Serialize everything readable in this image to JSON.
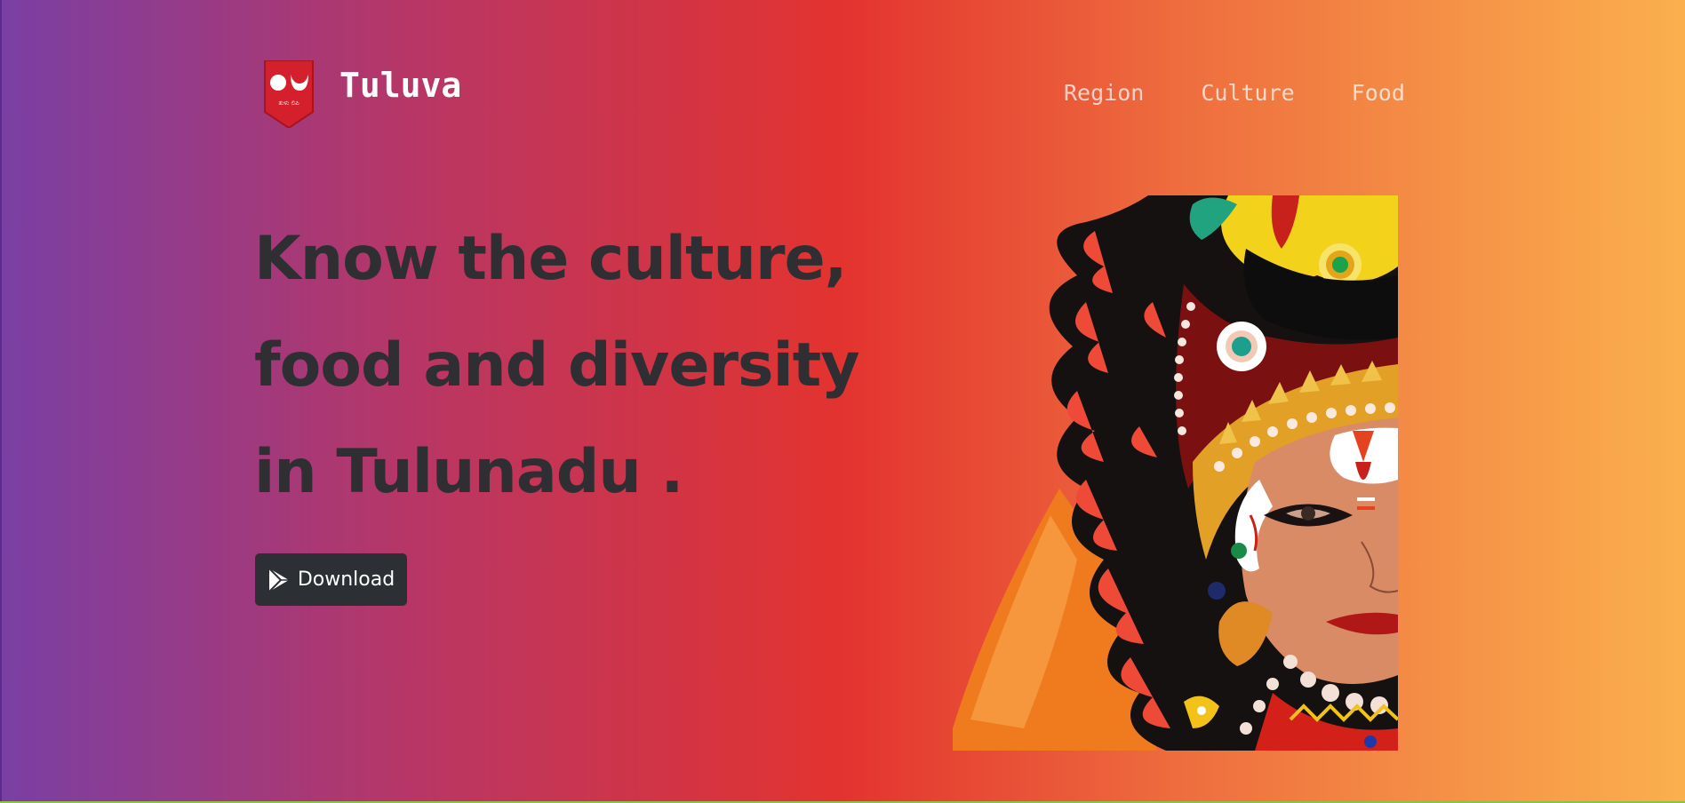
{
  "header": {
    "brand_name": "Tuluva",
    "logo_icon": "tulu-shield-logo-icon",
    "logo_caption": "ತುಳು ಲಿಪಿ",
    "nav": [
      {
        "label": "Region"
      },
      {
        "label": "Culture"
      },
      {
        "label": "Food"
      }
    ]
  },
  "hero": {
    "title_lines": [
      "Know the culture,",
      "food and diversity",
      "in Tulunadu ."
    ],
    "download_label": "Download",
    "download_icon": "play-store-icon",
    "artwork_icon": "yakshagana-face-illustration"
  },
  "colors": {
    "gradient_start": "#7a3fa4",
    "gradient_mid": "#e3332f",
    "gradient_end": "#fbb04e",
    "title_text": "#2f2f33",
    "button_bg": "#2c2f33",
    "logo_red": "#d41f2c"
  }
}
